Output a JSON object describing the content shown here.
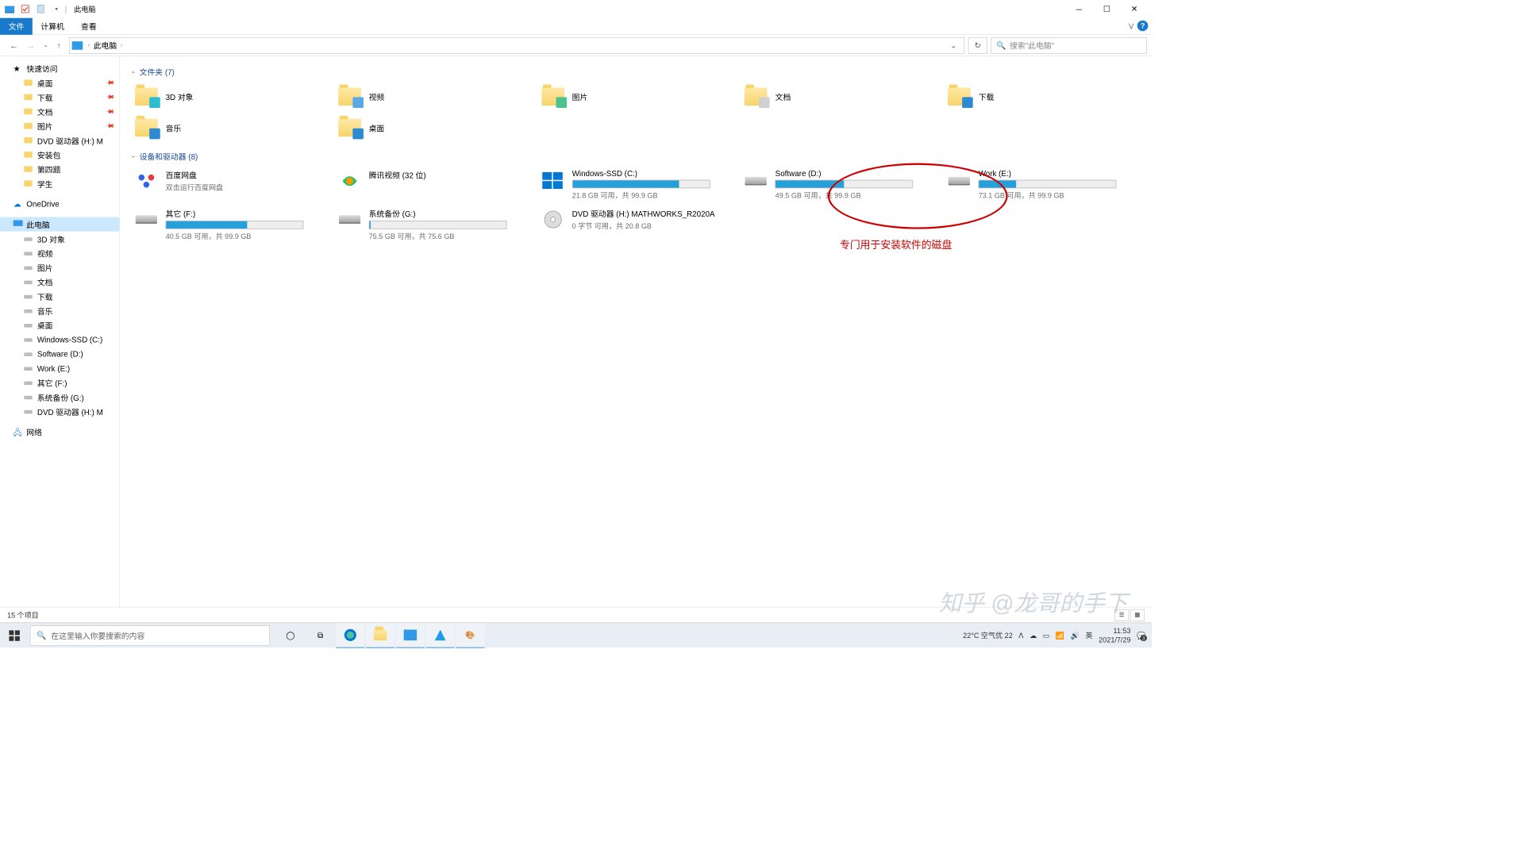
{
  "window": {
    "title": "此电脑"
  },
  "ribbon": {
    "file": "文件",
    "computer": "计算机",
    "view": "查看"
  },
  "nav": {
    "crumb": "此电脑"
  },
  "search": {
    "placeholder": "搜索\"此电脑\""
  },
  "sidebar": {
    "quick": "快速访问",
    "quick_items": [
      {
        "label": "桌面",
        "pin": true
      },
      {
        "label": "下载",
        "pin": true
      },
      {
        "label": "文档",
        "pin": true
      },
      {
        "label": "图片",
        "pin": true
      },
      {
        "label": "DVD 驱动器 (H:) M",
        "pin": false
      },
      {
        "label": "安装包",
        "pin": false
      },
      {
        "label": "第四题",
        "pin": false
      },
      {
        "label": "学生",
        "pin": false
      }
    ],
    "onedrive": "OneDrive",
    "thispc": "此电脑",
    "thispc_items": [
      "3D 对象",
      "视频",
      "图片",
      "文档",
      "下载",
      "音乐",
      "桌面",
      "Windows-SSD (C:)",
      "Software (D:)",
      "Work (E:)",
      "其它 (F:)",
      "系统备份 (G:)",
      "DVD 驱动器 (H:) M"
    ],
    "network": "网络"
  },
  "sections": {
    "folders_hdr": "文件夹 (7)",
    "devices_hdr": "设备和驱动器 (8)"
  },
  "folders": [
    "3D 对象",
    "视频",
    "图片",
    "文档",
    "下载",
    "音乐",
    "桌面"
  ],
  "drives": [
    {
      "name": "百度网盘",
      "sub": "双击运行百度网盘",
      "bar": false,
      "icon": "baidu"
    },
    {
      "name": "腾讯视频 (32 位)",
      "sub": "",
      "bar": false,
      "icon": "tencent"
    },
    {
      "name": "Windows-SSD (C:)",
      "sub": "21.8 GB 可用，共 99.9 GB",
      "bar": true,
      "pct": 78,
      "icon": "win"
    },
    {
      "name": "Software (D:)",
      "sub": "49.5 GB 可用，共 99.9 GB",
      "bar": true,
      "pct": 50,
      "icon": "drive"
    },
    {
      "name": "Work (E:)",
      "sub": "73.1 GB 可用，共 99.9 GB",
      "bar": true,
      "pct": 27,
      "icon": "drive"
    },
    {
      "name": "其它 (F:)",
      "sub": "40.5 GB 可用，共 99.9 GB",
      "bar": true,
      "pct": 59,
      "icon": "drive"
    },
    {
      "name": "系统备份 (G:)",
      "sub": "75.5 GB 可用，共 75.6 GB",
      "bar": true,
      "pct": 1,
      "icon": "drive"
    },
    {
      "name": "DVD 驱动器 (H:) MATHWORKS_R2020A",
      "sub": "0 字节 可用，共 20.8 GB",
      "bar": false,
      "icon": "dvd"
    }
  ],
  "annotation": "专门用于安装软件的磁盘",
  "statusbar": {
    "count": "15 个项目"
  },
  "watermark": "知乎 @龙哥的手下",
  "taskbar": {
    "search_placeholder": "在这里输入你要搜索的内容",
    "weather": "22°C  空气优 22",
    "ime": "英",
    "time": "11:53",
    "date": "2021/7/29",
    "notif": "3"
  }
}
